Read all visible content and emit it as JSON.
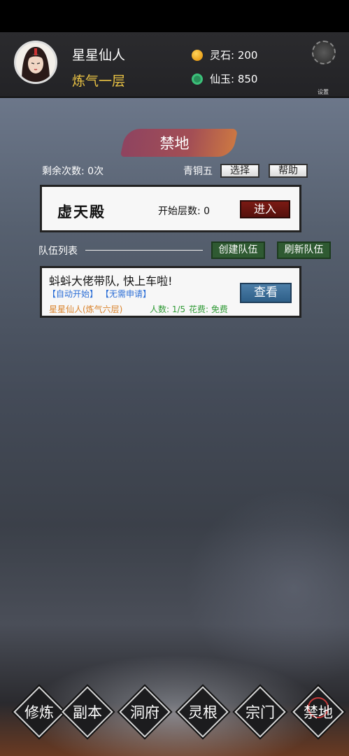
{
  "header": {
    "player_name": "星星仙人",
    "realm": "炼气一层",
    "resources": [
      {
        "icon": "spirit-stone-icon",
        "label": "灵石: 200"
      },
      {
        "icon": "jade-icon",
        "label": "仙玉: 850"
      }
    ],
    "settings_label": "设置"
  },
  "page": {
    "title": "禁地",
    "remaining": "剩余次数: 0次",
    "rank": "青铜五",
    "select_label": "选择",
    "help_label": "帮助"
  },
  "dungeon": {
    "name": "虚天殿",
    "start_floor": "开始层数: 0",
    "enter_label": "进入"
  },
  "teams": {
    "list_label": "队伍列表",
    "create_label": "创建队伍",
    "refresh_label": "刷新队伍",
    "items": [
      {
        "title": "蚪蚪大佬带队, 快上车啦!",
        "tag_auto": "【自动开始】",
        "tag_noapply": "【无需申请】",
        "leader": "星星仙人(炼气六层)",
        "count": "人数: 1/5",
        "cost": "花费: 免费",
        "view_label": "查看"
      }
    ]
  },
  "nav": {
    "items": [
      {
        "label": "修炼"
      },
      {
        "label": "副本"
      },
      {
        "label": "洞府"
      },
      {
        "label": "灵根"
      },
      {
        "label": "宗门"
      },
      {
        "label": "禁地"
      }
    ],
    "active": "禁地"
  }
}
